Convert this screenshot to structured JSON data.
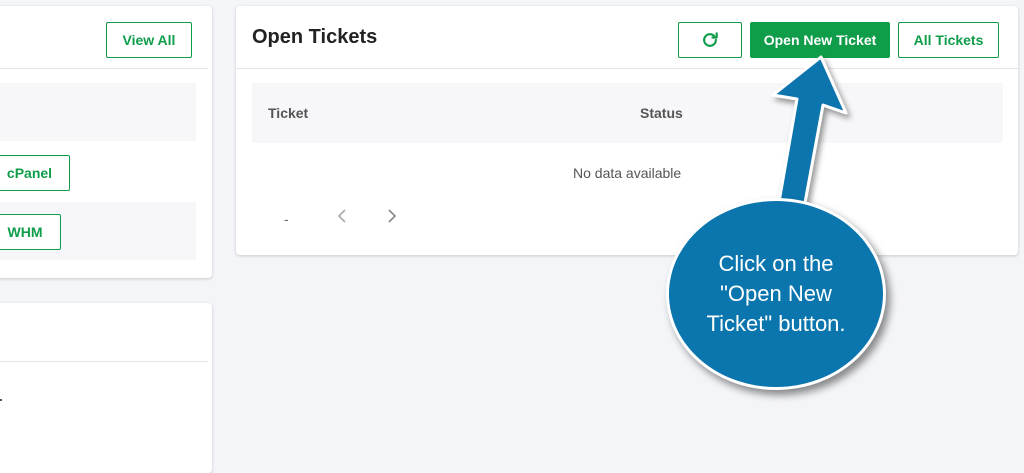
{
  "left_card": {
    "view_all_label": "View All",
    "cpanel_label": "cPanel",
    "whm_label": "WHM"
  },
  "tickets": {
    "title": "Open Tickets",
    "refresh_icon": "refresh-icon",
    "open_new_label": "Open New Ticket",
    "all_tickets_label": "All Tickets",
    "columns": [
      "Ticket",
      "Status"
    ],
    "empty_message": "No data available",
    "pager_range": "-",
    "prev_icon": "chevron-left-icon",
    "next_icon": "chevron-right-icon"
  },
  "callout": {
    "text": "Click on the \"Open New Ticket\" button."
  },
  "colors": {
    "accent": "#0f9d4a",
    "callout": "#0b75ae"
  }
}
